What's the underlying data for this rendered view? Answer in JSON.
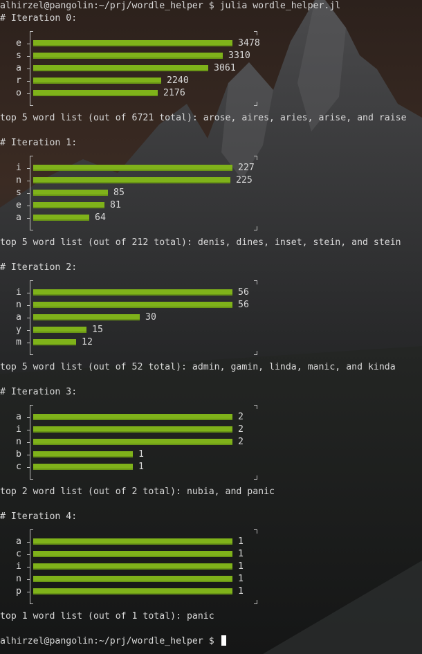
{
  "prompt_line": "alhirzel@pangolin:~/prj/wordle_helper $ julia wordle_helper.jl",
  "final_prompt": "alhirzel@pangolin:~/prj/wordle_helper $ ",
  "iterations": [
    {
      "header": "# Iteration 0:",
      "rows": [
        {
          "label": "e",
          "value": 3478
        },
        {
          "label": "s",
          "value": 3310
        },
        {
          "label": "a",
          "value": 3061
        },
        {
          "label": "r",
          "value": 2240
        },
        {
          "label": "o",
          "value": 2176
        }
      ],
      "summary": "top 5 word list (out of 6721 total): arose, aires, aries, arise, and raise"
    },
    {
      "header": "# Iteration 1:",
      "rows": [
        {
          "label": "i",
          "value": 227
        },
        {
          "label": "n",
          "value": 225
        },
        {
          "label": "s",
          "value": 85
        },
        {
          "label": "e",
          "value": 81
        },
        {
          "label": "a",
          "value": 64
        }
      ],
      "summary": "top 5 word list (out of 212 total): denis, dines, inset, stein, and stein"
    },
    {
      "header": "# Iteration 2:",
      "rows": [
        {
          "label": "i",
          "value": 56
        },
        {
          "label": "n",
          "value": 56
        },
        {
          "label": "a",
          "value": 30
        },
        {
          "label": "y",
          "value": 15
        },
        {
          "label": "m",
          "value": 12
        }
      ],
      "summary": "top 5 word list (out of 52 total): admin, gamin, linda, manic, and kinda"
    },
    {
      "header": "# Iteration 3:",
      "rows": [
        {
          "label": "a",
          "value": 2
        },
        {
          "label": "i",
          "value": 2
        },
        {
          "label": "n",
          "value": 2
        },
        {
          "label": "b",
          "value": 1
        },
        {
          "label": "c",
          "value": 1
        }
      ],
      "summary": "top 2 word list (out of 2 total): nubia, and panic"
    },
    {
      "header": "# Iteration 4:",
      "rows": [
        {
          "label": "a",
          "value": 1
        },
        {
          "label": "c",
          "value": 1
        },
        {
          "label": "i",
          "value": 1
        },
        {
          "label": "n",
          "value": 1
        },
        {
          "label": "p",
          "value": 1
        }
      ],
      "summary": "top 1 word list (out of 1 total): panic"
    }
  ],
  "colors": {
    "bar": "#7fb21a",
    "text": "#d9d9d9",
    "sky_top": "#3a2a22",
    "mountain": "#3c3c3e"
  }
}
